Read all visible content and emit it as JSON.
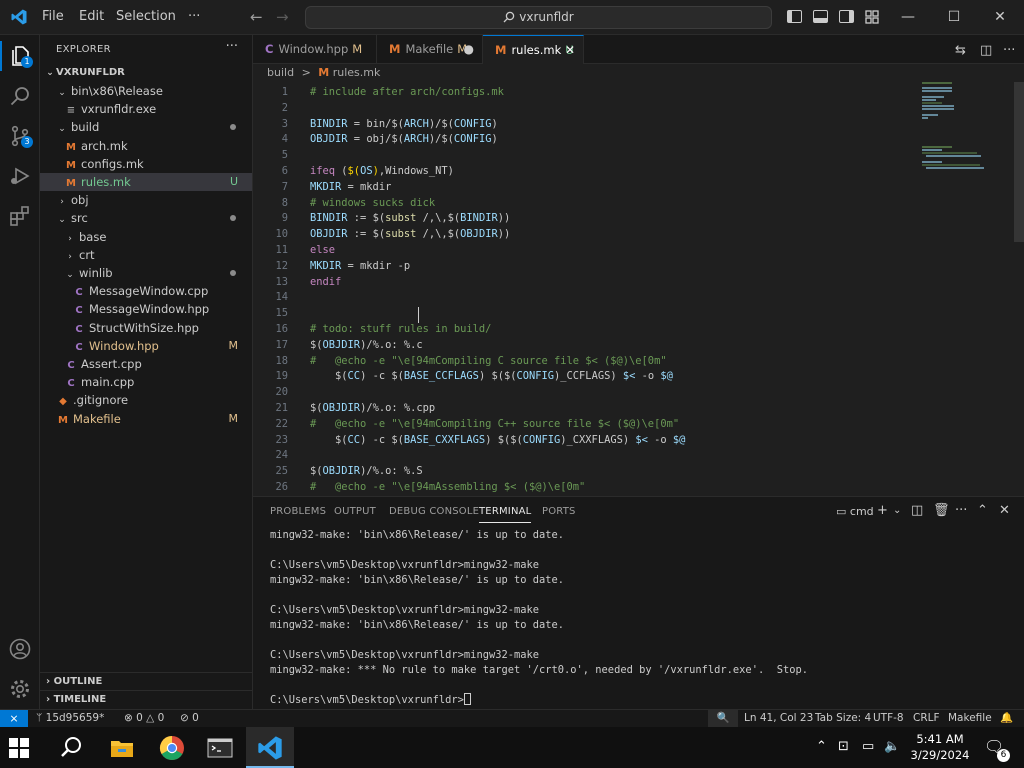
{
  "titlebar": {
    "menu": [
      "File",
      "Edit",
      "Selection",
      "···"
    ],
    "search_text": "vxrunfldr",
    "minimize": "—",
    "maximize": "☐",
    "close": "✕"
  },
  "activity": {
    "explorer_badge": "1",
    "scm_badge": "3"
  },
  "sidebar": {
    "title": "EXPLORER",
    "more": "···",
    "root": "VXRUNFLDR",
    "tree": [
      {
        "label": "bin\\x86\\Release",
        "kind": "folder",
        "open": true,
        "depth": 1
      },
      {
        "label": "vxrunfldr.exe",
        "kind": "file",
        "icon": "≡",
        "depth": 2
      },
      {
        "label": "build",
        "kind": "folder",
        "open": true,
        "depth": 1,
        "dot": true
      },
      {
        "label": "arch.mk",
        "kind": "file",
        "icon": "M",
        "depth": 2
      },
      {
        "label": "configs.mk",
        "kind": "file",
        "icon": "M",
        "depth": 2
      },
      {
        "label": "rules.mk",
        "kind": "file",
        "icon": "M",
        "depth": 2,
        "status": "U",
        "selected": true
      },
      {
        "label": "obj",
        "kind": "folder",
        "open": false,
        "depth": 1
      },
      {
        "label": "src",
        "kind": "folder",
        "open": true,
        "depth": 1,
        "dot": true
      },
      {
        "label": "base",
        "kind": "folder",
        "open": false,
        "depth": 2
      },
      {
        "label": "crt",
        "kind": "folder",
        "open": false,
        "depth": 2
      },
      {
        "label": "winlib",
        "kind": "folder",
        "open": true,
        "depth": 2,
        "dot": true
      },
      {
        "label": "MessageWindow.cpp",
        "kind": "file",
        "icon": "C",
        "depth": 3
      },
      {
        "label": "MessageWindow.hpp",
        "kind": "file",
        "icon": "C",
        "depth": 3
      },
      {
        "label": "StructWithSize.hpp",
        "kind": "file",
        "icon": "C",
        "depth": 3
      },
      {
        "label": "Window.hpp",
        "kind": "file",
        "icon": "C",
        "depth": 3,
        "status": "M"
      },
      {
        "label": "Assert.cpp",
        "kind": "file",
        "icon": "C",
        "depth": 2
      },
      {
        "label": "main.cpp",
        "kind": "file",
        "icon": "C",
        "depth": 2
      },
      {
        "label": ".gitignore",
        "kind": "file",
        "icon": "◆",
        "depth": 1
      },
      {
        "label": "Makefile",
        "kind": "file",
        "icon": "M",
        "depth": 1,
        "status": "M"
      }
    ],
    "outline": "OUTLINE",
    "timeline": "TIMELINE"
  },
  "tabs": [
    {
      "label": "Window.hpp",
      "icon": "C",
      "status": "M"
    },
    {
      "label": "Makefile",
      "icon": "M",
      "status": "M"
    },
    {
      "label": "rules.mk",
      "icon": "M",
      "status": "U"
    }
  ],
  "breadcrumb": {
    "folder": "build",
    "sep": ">",
    "file": "rules.mk"
  },
  "code": [
    "# include after arch/configs.mk",
    "",
    "BINDIR = bin/$(ARCH)/$(CONFIG)",
    "OBJDIR = obj/$(ARCH)/$(CONFIG)",
    "",
    "ifeq ($(OS),Windows_NT)",
    "MKDIR = mkdir",
    "# windows sucks dick",
    "BINDIR := $(subst /,\\,$(BINDIR))",
    "OBJDIR := $(subst /,\\,$(OBJDIR))",
    "else",
    "MKDIR = mkdir -p",
    "endif",
    "",
    "",
    "# todo: stuff rules in build/",
    "$(OBJDIR)/%.o: %.c",
    "#   @echo -e \"\\e[94mCompiling C source file $< ($@)\\e[0m\"",
    "    $(CC) -c $(BASE_CCFLAGS) $($(CONFIG)_CCFLAGS) $< -o $@",
    "",
    "$(OBJDIR)/%.o: %.cpp",
    "#   @echo -e \"\\e[94mCompiling C++ source file $< ($@)\\e[0m\"",
    "    $(CC) -c $(BASE_CXXFLAGS) $($(CONFIG)_CXXFLAGS) $< -o $@",
    "",
    "$(OBJDIR)/%.o: %.S",
    "#   @echo -e \"\\e[94mAssembling $< ($@)\\e[0m\""
  ],
  "panel": {
    "tabs": [
      "PROBLEMS",
      "OUTPUT",
      "DEBUG CONSOLE",
      "TERMINAL",
      "PORTS"
    ],
    "active_tab": "TERMINAL",
    "shell": "cmd",
    "terminal": [
      "mingw32-make: 'bin\\x86\\Release/' is up to date.",
      "",
      "C:\\Users\\vm5\\Desktop\\vxrunfldr>mingw32-make",
      "mingw32-make: 'bin\\x86\\Release/' is up to date.",
      "",
      "C:\\Users\\vm5\\Desktop\\vxrunfldr>mingw32-make",
      "mingw32-make: 'bin\\x86\\Release/' is up to date.",
      "",
      "C:\\Users\\vm5\\Desktop\\vxrunfldr>mingw32-make",
      "mingw32-make: *** No rule to make target '/crt0.o', needed by '/vxrunfldr.exe'.  Stop.",
      "",
      "C:\\Users\\vm5\\Desktop\\vxrunfldr>"
    ]
  },
  "statusbar": {
    "branch": "15d95659*",
    "errors": "0",
    "warnings": "0",
    "ports": "0",
    "position": "Ln 41, Col 23",
    "tab_size": "Tab Size: 4",
    "encoding": "UTF-8",
    "eol": "CRLF",
    "language": "Makefile"
  },
  "taskbar": {
    "time": "5:41 AM",
    "date": "3/29/2024",
    "notifications": "6"
  },
  "colors": {
    "accent": "#0078d4",
    "modified": "#e2c08d",
    "untracked": "#73c991",
    "makefile_icon": "#e37933",
    "cpp_icon": "#a074c4"
  }
}
